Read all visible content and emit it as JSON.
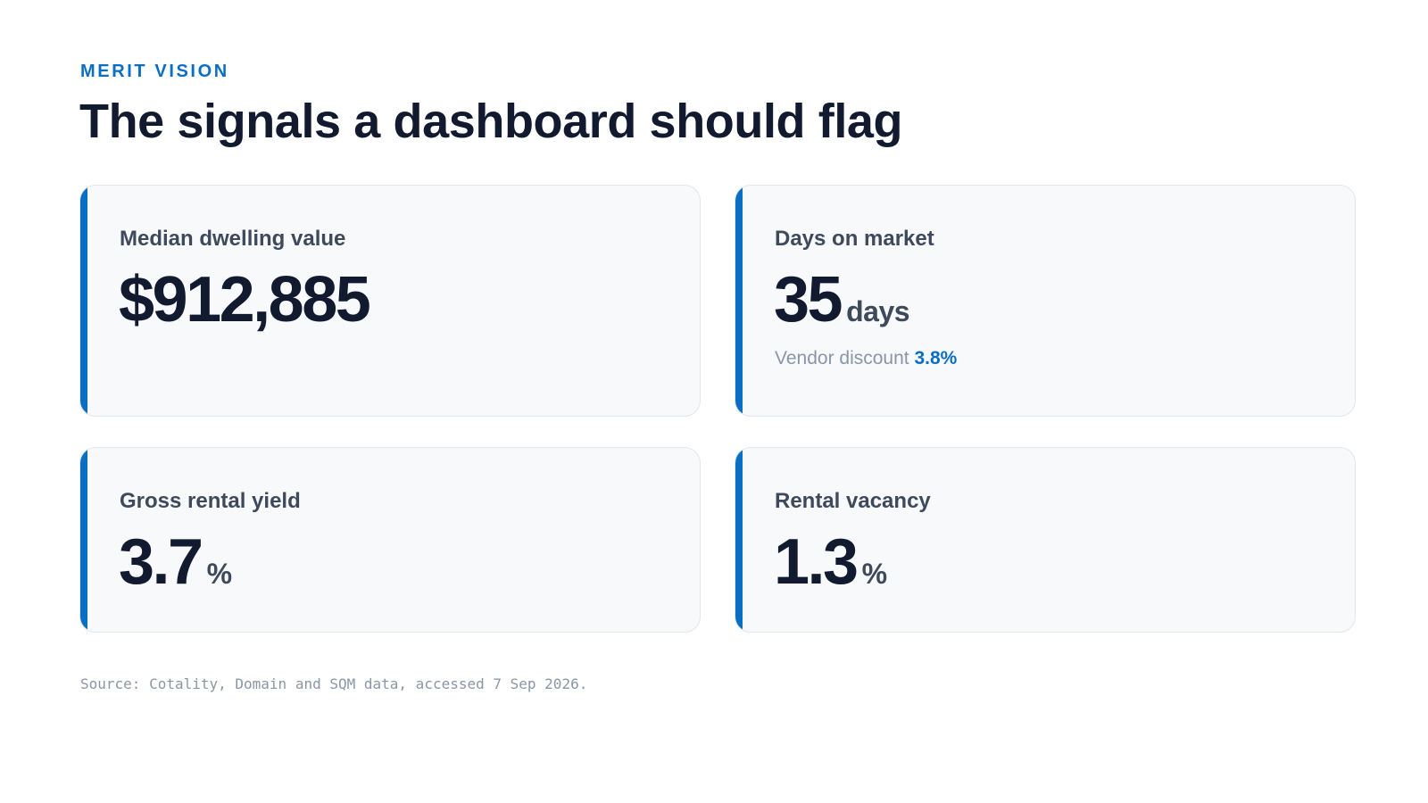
{
  "header": {
    "brand": "MERIT VISION",
    "title": "The signals a dashboard should flag"
  },
  "cards": [
    {
      "label": "Median dwelling value",
      "value": "$912,885",
      "unit": ""
    },
    {
      "label": "Days on market",
      "value": "35",
      "unit": "days",
      "sub_label": "Vendor discount",
      "sub_value": "3.8%"
    },
    {
      "label": "Gross rental yield",
      "value": "3.7",
      "unit": "%"
    },
    {
      "label": "Rental vacancy",
      "value": "1.3",
      "unit": "%"
    }
  ],
  "footer": {
    "source": "Source: Cotality, Domain and SQM data, accessed 7 Sep 2026."
  },
  "colors": {
    "accent": "#0a6fc2",
    "title": "#111a2e",
    "label": "#3e4a5c",
    "muted": "#8a96a8",
    "card_bg": "#f8f9fb"
  }
}
